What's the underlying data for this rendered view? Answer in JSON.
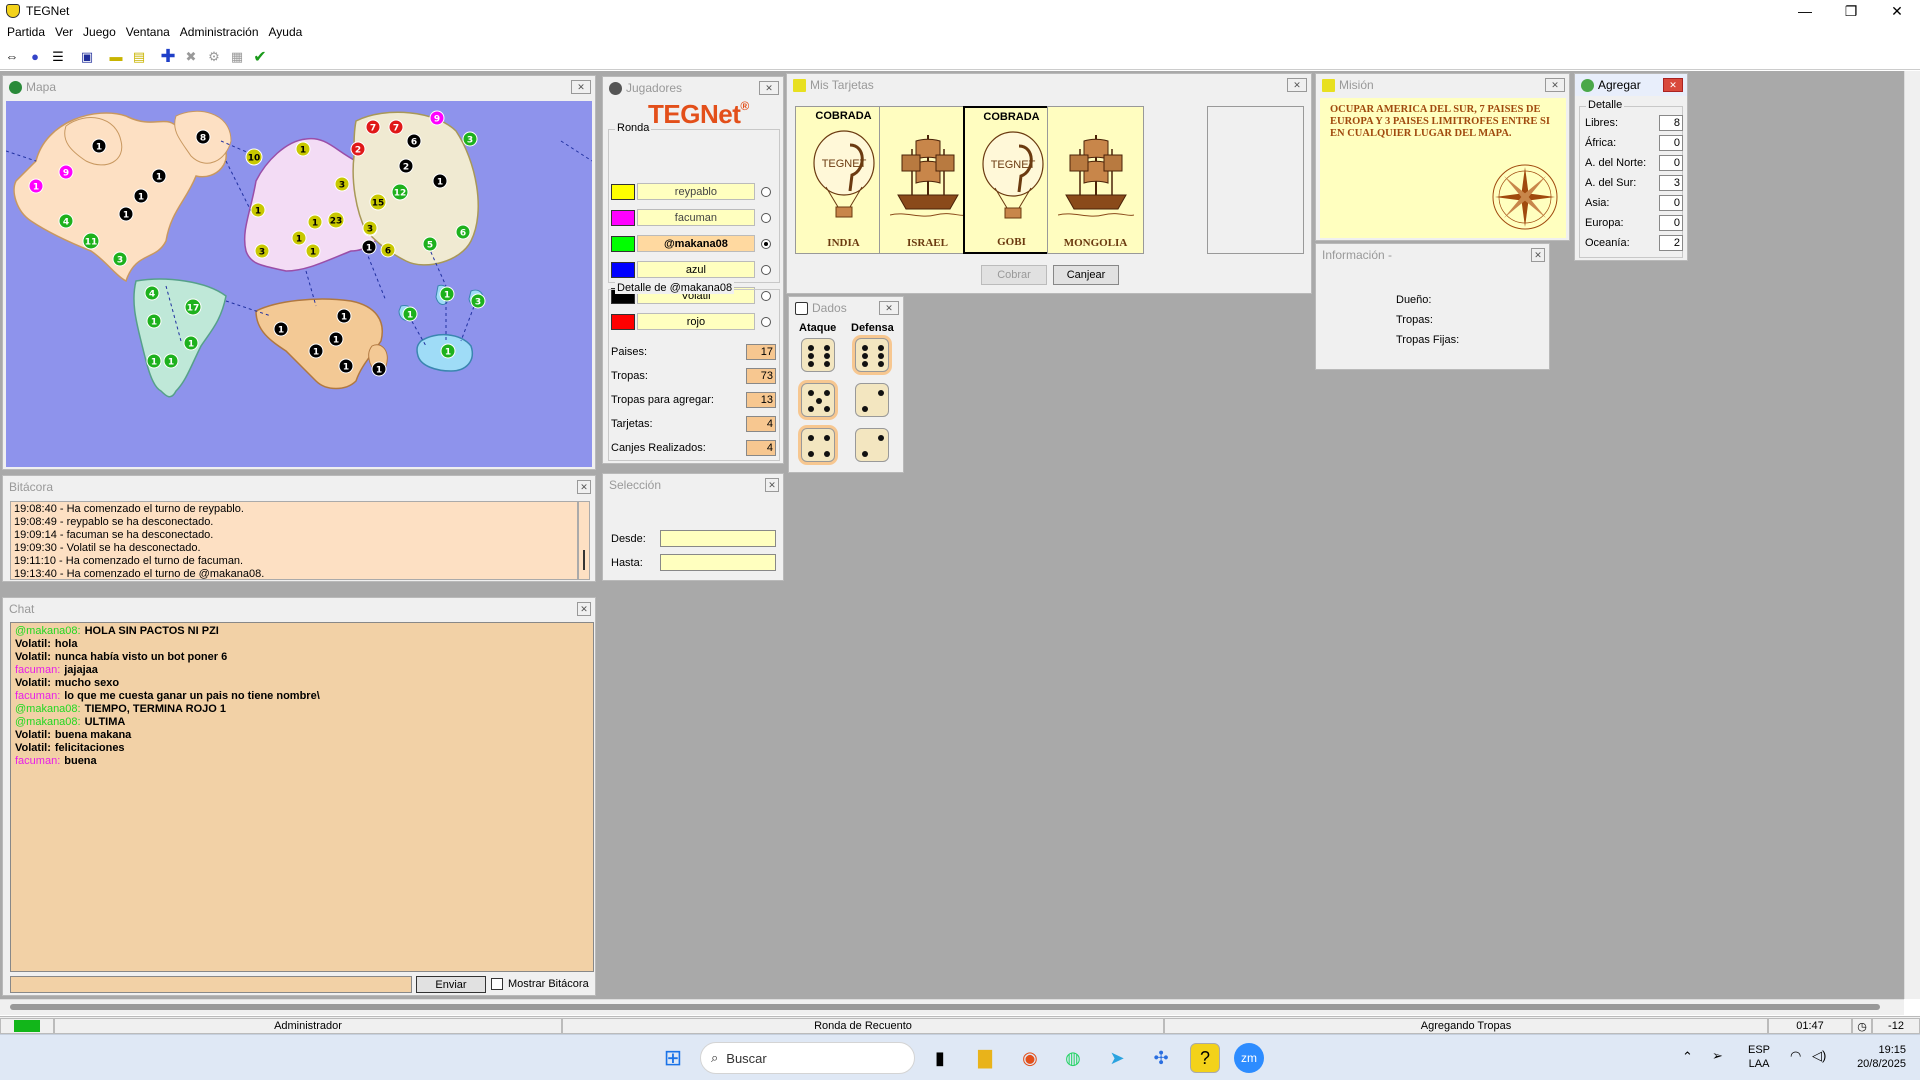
{
  "window": {
    "title": "TEGNet",
    "minimize": "—",
    "maximize": "❐",
    "close": "✕"
  },
  "menu": [
    "Partida",
    "Ver",
    "Juego",
    "Ventana",
    "Administración",
    "Ayuda"
  ],
  "toolbar_icons": [
    "connect-icon",
    "globe-icon",
    "list-icon",
    "save-icon",
    "card-icon",
    "mission-icon",
    "add-icon",
    "cancel-icon",
    "attack-icon",
    "regroup-icon",
    "confirm-icon"
  ],
  "map": {
    "title": "Mapa",
    "colors": {
      "sea": "#8e93ec",
      "america_norte": "#fde0c3",
      "america_sur": "#bfe8d8",
      "europa": "#f3dcf5",
      "asia": "#f0ead2",
      "africa": "#f3c995",
      "oceania": "#9fdcf7"
    },
    "armies": [
      {
        "n": "1",
        "c": "#000"
      },
      {
        "n": "8",
        "c": "#000"
      },
      {
        "n": "9",
        "c": "#f0f"
      },
      {
        "n": "1",
        "c": "#000"
      },
      {
        "n": "1",
        "c": "#f0f"
      },
      {
        "n": "1",
        "c": "#000"
      },
      {
        "n": "4",
        "c": "#1db11d"
      },
      {
        "n": "1",
        "c": "#000"
      },
      {
        "n": "11",
        "c": "#1db11d"
      },
      {
        "n": "3",
        "c": "#1db11d"
      },
      {
        "n": "10",
        "c": "#c8c800"
      },
      {
        "n": "1",
        "c": "#c8c800"
      },
      {
        "n": "1",
        "c": "#c8c800"
      },
      {
        "n": "3",
        "c": "#c8c800"
      },
      {
        "n": "1",
        "c": "#c8c800"
      },
      {
        "n": "1",
        "c": "#c8c800"
      },
      {
        "n": "23",
        "c": "#c8c800"
      },
      {
        "n": "3",
        "c": "#c8c800"
      },
      {
        "n": "1",
        "c": "#c8c800"
      },
      {
        "n": "3",
        "c": "#c8c800"
      },
      {
        "n": "7",
        "c": "#e01818"
      },
      {
        "n": "7",
        "c": "#e01818"
      },
      {
        "n": "2",
        "c": "#e01818"
      },
      {
        "n": "9",
        "c": "#f0f"
      },
      {
        "n": "6",
        "c": "#000"
      },
      {
        "n": "2",
        "c": "#000"
      },
      {
        "n": "1",
        "c": "#000"
      },
      {
        "n": "3",
        "c": "#1db11d"
      },
      {
        "n": "15",
        "c": "#c8c800"
      },
      {
        "n": "12",
        "c": "#1db11d"
      },
      {
        "n": "3",
        "c": "#c8c800"
      },
      {
        "n": "1",
        "c": "#000"
      },
      {
        "n": "6",
        "c": "#c8c800"
      },
      {
        "n": "5",
        "c": "#1db11d"
      },
      {
        "n": "6",
        "c": "#1db11d"
      },
      {
        "n": "4",
        "c": "#1db11d"
      },
      {
        "n": "17",
        "c": "#1db11d"
      },
      {
        "n": "1",
        "c": "#1db11d"
      },
      {
        "n": "1",
        "c": "#1db11d"
      },
      {
        "n": "1",
        "c": "#1db11d"
      },
      {
        "n": "1",
        "c": "#1db11d"
      },
      {
        "n": "1",
        "c": "#000"
      },
      {
        "n": "1",
        "c": "#000"
      },
      {
        "n": "1",
        "c": "#000"
      },
      {
        "n": "1",
        "c": "#000"
      },
      {
        "n": "1",
        "c": "#000"
      },
      {
        "n": "1",
        "c": "#000"
      },
      {
        "n": "1",
        "c": "#1db11d"
      },
      {
        "n": "1",
        "c": "#1db11d"
      },
      {
        "n": "3",
        "c": "#1db11d"
      },
      {
        "n": "1",
        "c": "#1db11d"
      }
    ]
  },
  "bitacora": {
    "title": "Bitácora",
    "lines": [
      "19:08:40 - Ha comenzado el turno de reypablo.",
      "19:08:49 - reypablo se ha desconectado.",
      "19:09:14 - facuman se ha desconectado.",
      "19:09:30 - Volatil se ha desconectado.",
      "19:11:10 - Ha comenzado el turno de facuman.",
      "19:13:40 - Ha comenzado el turno de @makana08."
    ]
  },
  "chat": {
    "title": "Chat",
    "messages": [
      {
        "user": "@makana08:",
        "text": "HOLA SIN PACTOS NI PZI",
        "color": "#21d821"
      },
      {
        "user": "Volatil:",
        "text": "hola",
        "color": "#000000"
      },
      {
        "user": "Volatil:",
        "text": "nunca había visto un bot poner 6",
        "color": "#000000"
      },
      {
        "user": "facuman:",
        "text": "jajajaa",
        "color": "#e81ee8"
      },
      {
        "user": "Volatil:",
        "text": "mucho sexo",
        "color": "#000000"
      },
      {
        "user": "facuman:",
        "text": "lo que me cuesta ganar un pais no tiene nombre\\",
        "color": "#e81ee8"
      },
      {
        "user": "@makana08:",
        "text": "TIEMPO, TERMINA ROJO 1",
        "color": "#21d821"
      },
      {
        "user": "@makana08:",
        "text": "ULTIMA",
        "color": "#21d821"
      },
      {
        "user": "Volatil:",
        "text": "buena makana",
        "color": "#000000"
      },
      {
        "user": "Volatil:",
        "text": "felicitaciones",
        "color": "#000000"
      },
      {
        "user": "facuman:",
        "text": "buena",
        "color": "#e81ee8"
      }
    ],
    "send_label": "Enviar",
    "show_log_label": "Mostrar Bitácora"
  },
  "jugadores": {
    "title": "Jugadores",
    "logo_a": "TEG",
    "logo_b": "Net",
    "logo_reg": "®",
    "ronda_label": "Ronda",
    "players": [
      {
        "name": "reypablo",
        "color": "#ffff00",
        "active": false
      },
      {
        "name": "facuman",
        "color": "#ff00ff",
        "active": false
      },
      {
        "name": "@makana08",
        "color": "#00ff00",
        "active": true
      },
      {
        "name": "azul",
        "color": "#0000ff",
        "active": false
      },
      {
        "name": "Volatil",
        "color": "#000000",
        "active": false
      },
      {
        "name": "rojo",
        "color": "#ff0000",
        "active": false
      }
    ],
    "detalle_label": "Detalle de @makana08",
    "detalle": [
      {
        "label": "Paises:",
        "value": "17"
      },
      {
        "label": "Tropas:",
        "value": "73"
      },
      {
        "label": "Tropas para agregar:",
        "value": "13"
      },
      {
        "label": "Tarjetas:",
        "value": "4"
      },
      {
        "label": "Canjes Realizados:",
        "value": "4"
      }
    ]
  },
  "seleccion": {
    "title": "Selección",
    "desde_label": "Desde:",
    "hasta_label": "Hasta:"
  },
  "tarjetas": {
    "title": "Mis Tarjetas",
    "cards": [
      {
        "top": "COBRADA",
        "name": "INDIA",
        "kind": "balloon",
        "selected": false
      },
      {
        "top": "",
        "name": "ISRAEL",
        "kind": "ship",
        "selected": false
      },
      {
        "top": "COBRADA",
        "name": "GOBI",
        "kind": "balloon",
        "selected": true
      },
      {
        "top": "",
        "name": "MONGOLIA",
        "kind": "ship",
        "selected": false
      }
    ],
    "balloon_text": "TEGNET",
    "cobrar_label": "Cobrar",
    "canjear_label": "Canjear"
  },
  "dados": {
    "title": "Dados",
    "ataque_label": "Ataque",
    "defensa_label": "Defensa",
    "ataque": [
      6,
      5,
      4
    ],
    "defensa": [
      6,
      2,
      2
    ]
  },
  "mision": {
    "title": "Misión",
    "text": "OCUPAR AMERICA DEL SUR, 7 PAISES DE EUROPA Y 3 PAISES LIMITROFES ENTRE SI EN CUALQUIER LUGAR DEL MAPA."
  },
  "informacion": {
    "title": "Información -",
    "dueno_label": "Dueño:",
    "tropas_label": "Tropas:",
    "fijas_label": "Tropas Fijas:"
  },
  "agregar": {
    "title": "Agregar",
    "detalle_label": "Detalle",
    "rows": [
      {
        "label": "Libres:",
        "value": "8"
      },
      {
        "label": "África:",
        "value": "0"
      },
      {
        "label": "A. del Norte:",
        "value": "0"
      },
      {
        "label": "A. del Sur:",
        "value": "3"
      },
      {
        "label": "Asia:",
        "value": "0"
      },
      {
        "label": "Europa:",
        "value": "0"
      },
      {
        "label": "Oceanía:",
        "value": "2"
      }
    ]
  },
  "status": {
    "user": "Administrador",
    "phase": "Ronda de Recuento",
    "action": "Agregando Tropas",
    "timer": "01:47",
    "delta": "-12"
  },
  "taskbar": {
    "search_placeholder": "Buscar",
    "lang_1": "ESP",
    "lang_2": "LAA",
    "time": "19:15",
    "date": "20/8/2025"
  }
}
